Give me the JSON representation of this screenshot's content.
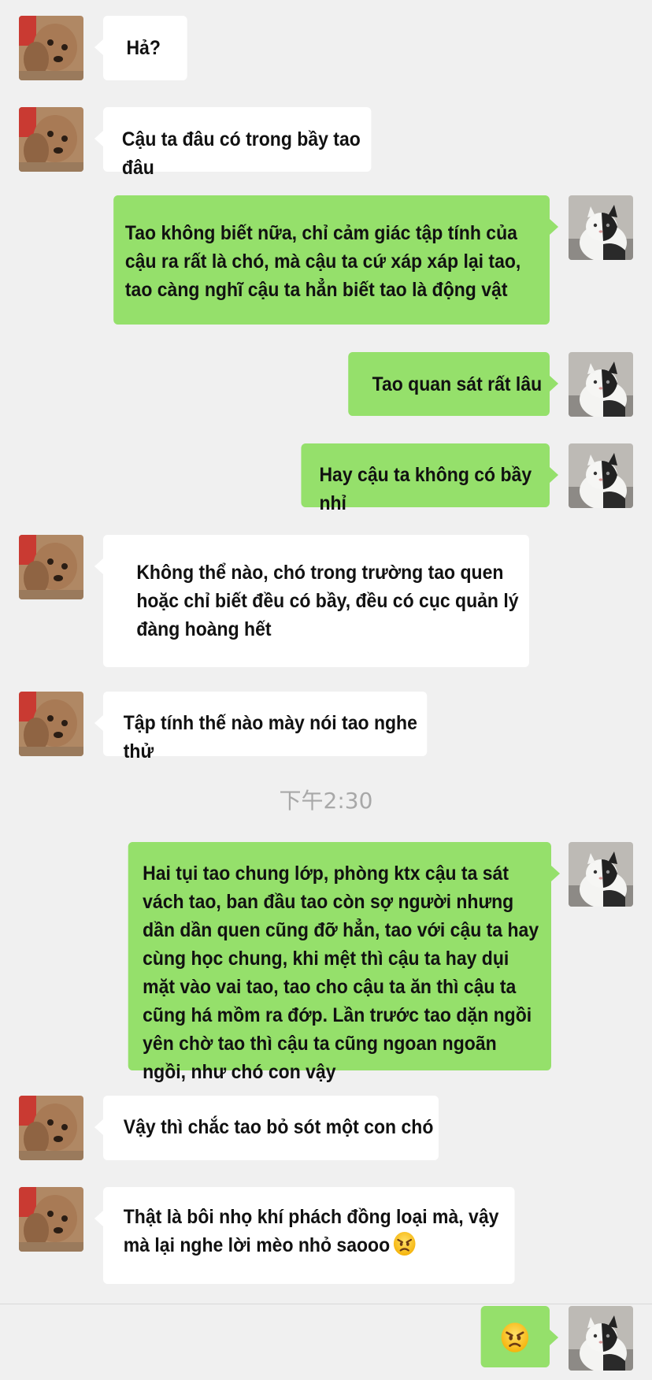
{
  "messages": [
    {
      "text": "Hả?"
    },
    {
      "text": "Cậu ta đâu có trong bầy tao đâu"
    },
    {
      "text": "Tao không biết nữa, chỉ cảm giác  tập tính của cậu ra rất là chó, mà cậu ta cứ xáp xáp lại tao, tao càng nghĩ cậu ta hẳn biết tao là động vật"
    },
    {
      "text": "Tao quan sát rất lâu"
    },
    {
      "text": "Hay cậu ta không có bầy nhỉ"
    },
    {
      "text": "Không thể nào, chó trong trường tao quen hoặc chỉ biết đều có bầy, đều có cục quản lý đàng hoàng hết"
    },
    {
      "text": "Tập tính thế nào mày nói tao nghe thử"
    },
    {
      "text": "Hai tụi tao chung lớp, phòng ktx cậu ta sát vách tao, ban đầu tao còn sợ người nhưng dần dần quen cũng đỡ hẳn, tao với cậu ta hay cùng học chung, khi mệt thì cậu ta hay dụi mặt vào vai tao, tao cho cậu ta ăn thì cậu ta cũng há mồm ra đớp. Lần trước tao dặn ngồi yên chờ tao thì cậu ta cũng ngoan ngoãn ngồi, như chó con vậy"
    },
    {
      "text": "Vậy thì chắc tao bỏ sót một con chó"
    },
    {
      "text": "Thật là bôi nhọ khí phách đồng loại mà, vậy mà lại nghe lời mèo nhỏ saooo",
      "emoji": "angry-face"
    },
    {
      "text": "",
      "emoji": "angry-face"
    }
  ],
  "timestamp": "下午2:30",
  "colors": {
    "background": "#f0f0f0",
    "incoming": "#ffffff",
    "outgoing": "#95e06b",
    "timestamp": "#a8a8a8"
  }
}
